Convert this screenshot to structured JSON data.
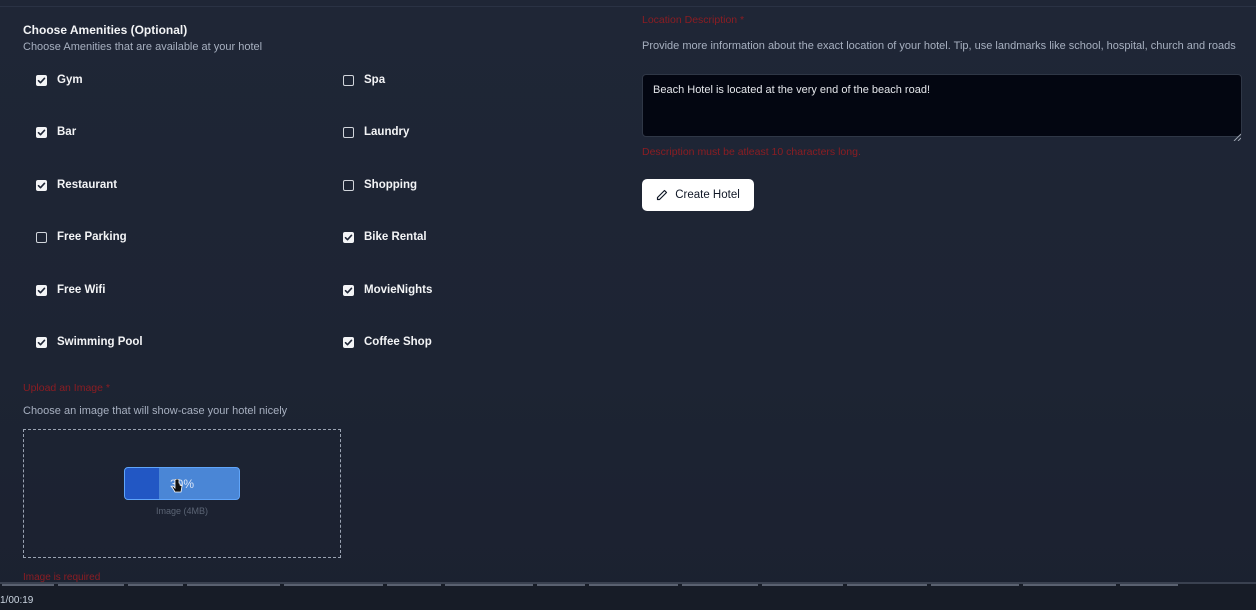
{
  "amenities": {
    "title": "Choose Amenities (Optional)",
    "subtitle": "Choose Amenities that are available at your hotel",
    "items": [
      {
        "label": "Gym",
        "checked": true
      },
      {
        "label": "Spa",
        "checked": false
      },
      {
        "label": "Bar",
        "checked": true
      },
      {
        "label": "Laundry",
        "checked": false
      },
      {
        "label": "Restaurant",
        "checked": true
      },
      {
        "label": "Shopping",
        "checked": false
      },
      {
        "label": "Free Parking",
        "checked": false
      },
      {
        "label": "Bike Rental",
        "checked": true
      },
      {
        "label": "Free Wifi",
        "checked": true
      },
      {
        "label": "MovieNights",
        "checked": true
      },
      {
        "label": "Swimming Pool",
        "checked": true
      },
      {
        "label": "Coffee Shop",
        "checked": true
      }
    ]
  },
  "image_upload": {
    "label": "Upload an Image *",
    "description": "Choose an image that will show-case your hotel nicely",
    "progress_text": "30%",
    "progress_value": 0.3,
    "hint": "Image (4MB)",
    "error": "Image is required"
  },
  "location": {
    "label": "Location Description *",
    "description": "Provide more information about the exact location of your hotel. Tip, use landmarks like school, hospital, church and roads",
    "value": "Beach Hotel is located at the very end of the beach road!",
    "error": "Description must be atleast 10 characters long."
  },
  "actions": {
    "create_label": "Create Hotel"
  },
  "taskbar": {
    "text": "1/00:19"
  },
  "colors": {
    "background": "#1f2636",
    "error": "#8b1d23",
    "progress": "#4a86d6",
    "progress_fill": "#2257c4"
  }
}
